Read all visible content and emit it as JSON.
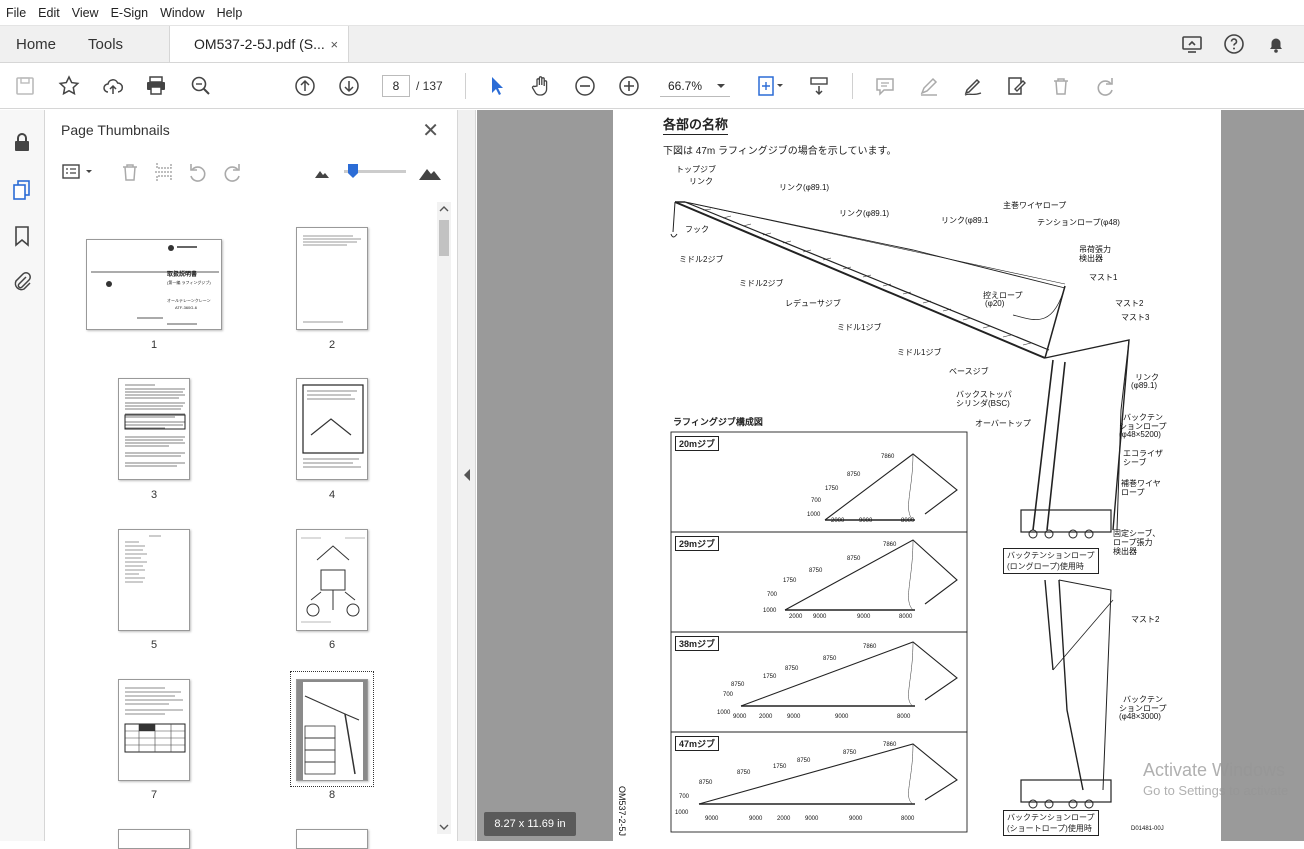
{
  "menu": [
    "File",
    "Edit",
    "View",
    "E-Sign",
    "Window",
    "Help"
  ],
  "tabs": {
    "home": "Home",
    "tools": "Tools",
    "document": "OM537-2-5J.pdf (S...",
    "close": "×"
  },
  "toolbar": {
    "current_page": "8",
    "page_total": "/  137",
    "zoom": "66.7%"
  },
  "panel": {
    "title": "Page Thumbnails",
    "close": "✕",
    "thumbnails": [
      {
        "label": "1"
      },
      {
        "label": "2"
      },
      {
        "label": "3"
      },
      {
        "label": "4"
      },
      {
        "label": "5"
      },
      {
        "label": "6"
      },
      {
        "label": "7"
      },
      {
        "label": "8"
      }
    ],
    "thumbnail_text": {
      "p1_title": "取扱説明書",
      "p1_sub": "(第一編 ラフィングジブ)",
      "p1_model": "オールテレーンクレーン",
      "p1_model2": "ATF-360G-6"
    }
  },
  "document": {
    "heading": "各部の名称",
    "intro": "下図は 47m ラフィングジブの場合を示しています。",
    "section_title": "ラフィングジブ構成図",
    "jibs": [
      {
        "label": "20mジブ"
      },
      {
        "label": "29mジブ"
      },
      {
        "label": "38mジブ"
      },
      {
        "label": "47mジブ"
      }
    ],
    "labels": {
      "top_jib": "トップジブ",
      "link": "リンク",
      "link_phi1": "リンク(φ89.1)",
      "link_phi2": "リンク(φ89.1)",
      "link_phi3": "リンク(φ89.1",
      "main_wire": "主巻ワイヤロープ",
      "tension_rope": "テンションロープ(φ48)",
      "hook": "フック",
      "middle2_a": "ミドル2ジブ",
      "middle2_b": "ミドル2ジブ",
      "reducer": "レデューサジブ",
      "middle1_a": "ミドル1ジブ",
      "middle1_b": "ミドル1ジブ",
      "base": "ベースジブ",
      "backstop": "バックストッパ",
      "backstop2": "シリンダ(BSC)",
      "overtop": "オーバートップ",
      "tension_det": "吊荷張力",
      "tension_det2": "検出器",
      "mast1": "マスト1",
      "mast2": "マスト2",
      "mast3": "マスト3",
      "rope20": "控えロープ",
      "rope20b": "(φ20)",
      "link_r": "リンク",
      "link_r2": "(φ89.1)",
      "backten": "バックテン",
      "backten2": "ションロープ",
      "backten3": "(φ48×5200)",
      "equalizer": "エコライザ",
      "equalizer2": "シーブ",
      "aux_wire": "補巻ワイヤ",
      "aux_wire2": "ロープ",
      "fixed_sheave": "固定シーブ、",
      "fixed_sheave2": "ロープ張力",
      "fixed_sheave3": "検出器",
      "long_rope": "バックテンションロープ",
      "long_rope2": "(ロングロープ)使用時",
      "mast2_b": "マスト2",
      "backten_b": "バックテン",
      "backten_b2": "ションロープ",
      "backten_b3": "(φ48×3000)",
      "short_rope": "バックテンションロープ",
      "short_rope2": "(ショートロープ)使用時",
      "doc_code": "D01481-00J",
      "side_code": "OM537-2-5J"
    },
    "dims": {
      "j20": [
        "1000",
        "700",
        "1750",
        "8750",
        "7860",
        "2000",
        "9000",
        "8000"
      ],
      "j29": [
        "1000",
        "700",
        "1750",
        "8750",
        "8750",
        "7860",
        "2000",
        "9000",
        "9000",
        "8000"
      ],
      "j38": [
        "1000",
        "700",
        "8750",
        "1750",
        "8750",
        "8750",
        "7860",
        "9000",
        "2000",
        "9000",
        "9000",
        "8000"
      ],
      "j47": [
        "1000",
        "700",
        "8750",
        "8750",
        "1750",
        "8750",
        "8750",
        "7860",
        "9000",
        "9000",
        "2000",
        "9000",
        "9000",
        "8000"
      ]
    }
  },
  "status": {
    "page_size": "8.27 x 11.69 in"
  },
  "watermark": {
    "line1": "Activate Windows",
    "line2": "Go to Settings to activate"
  }
}
